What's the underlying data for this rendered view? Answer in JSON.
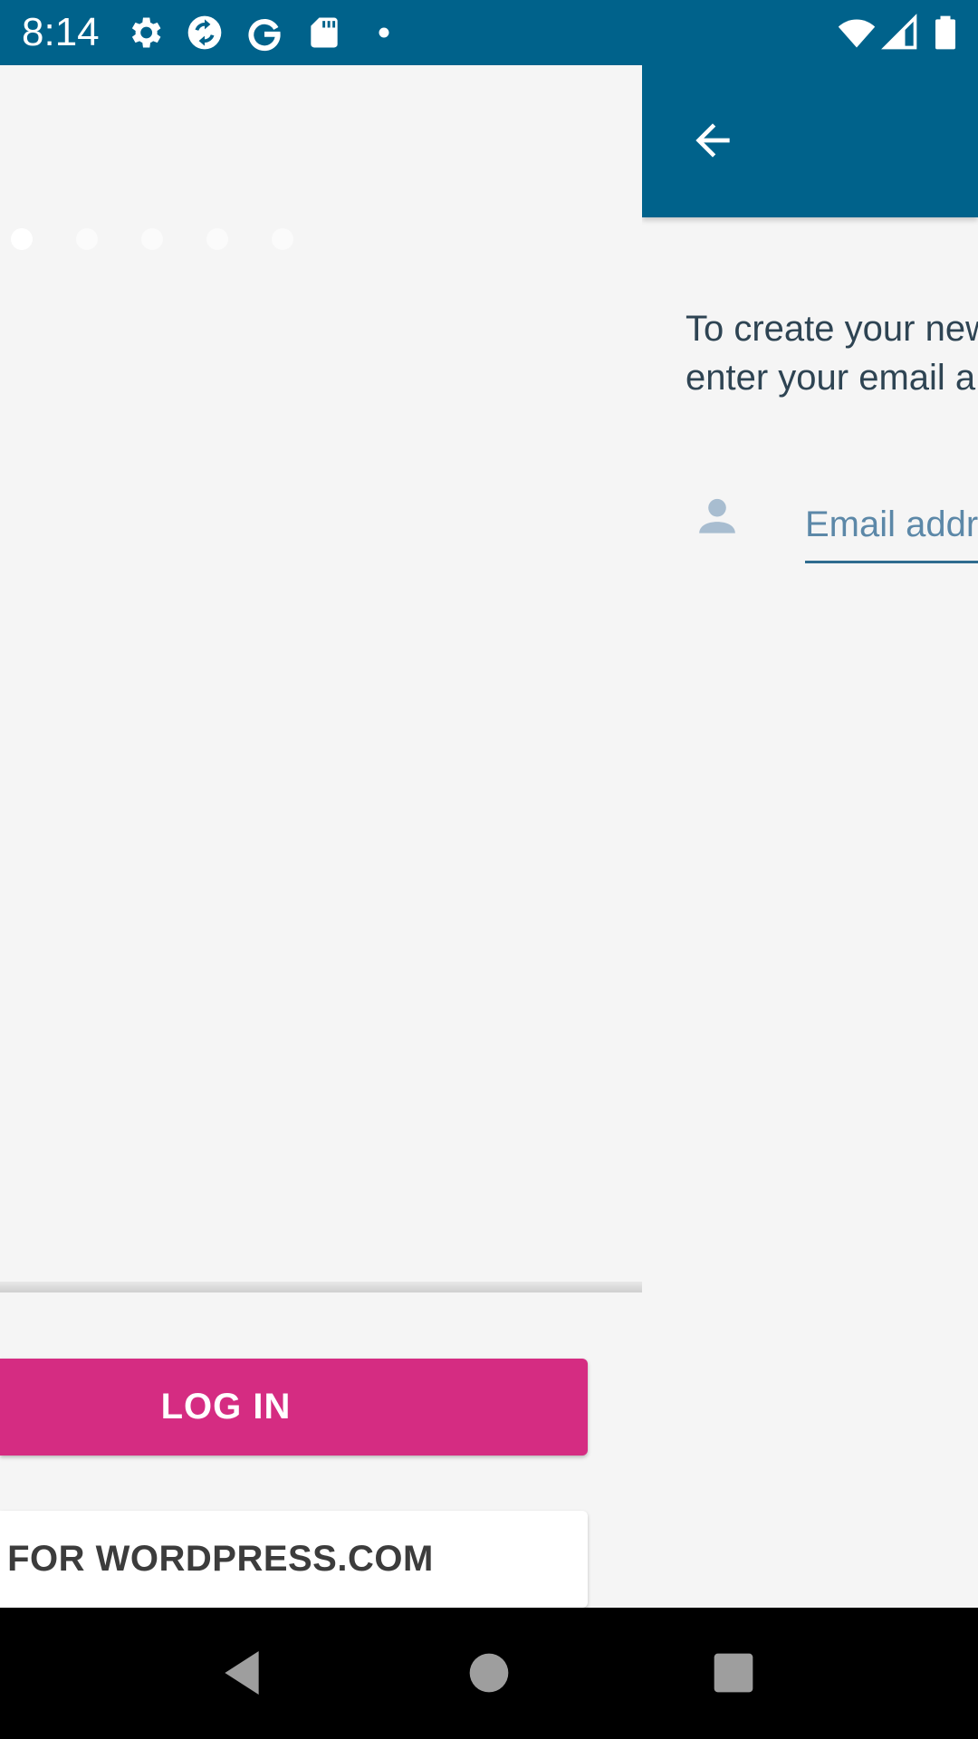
{
  "status_bar": {
    "time": "8:14",
    "left_icons": [
      "gear-icon",
      "sync-icon",
      "google-icon",
      "sd-card-icon",
      "notification-dot-icon"
    ],
    "right_icons": [
      "wifi-icon",
      "signal-icon",
      "battery-icon"
    ],
    "background": "#00628b"
  },
  "left_screen": {
    "page_indicator": {
      "count": 5,
      "active_index": 0
    },
    "login_button": "LOG IN",
    "signup_button": "P FOR WORDPRESS.COM",
    "accent": "#d52c82"
  },
  "right_screen": {
    "app_bar_color": "#00628b",
    "intro_text": "To create your new\nenter your email a",
    "email_placeholder": "Email addr"
  },
  "nav_bar": {
    "buttons": [
      "back-triangle-icon",
      "home-circle-icon",
      "recents-square-icon"
    ]
  }
}
